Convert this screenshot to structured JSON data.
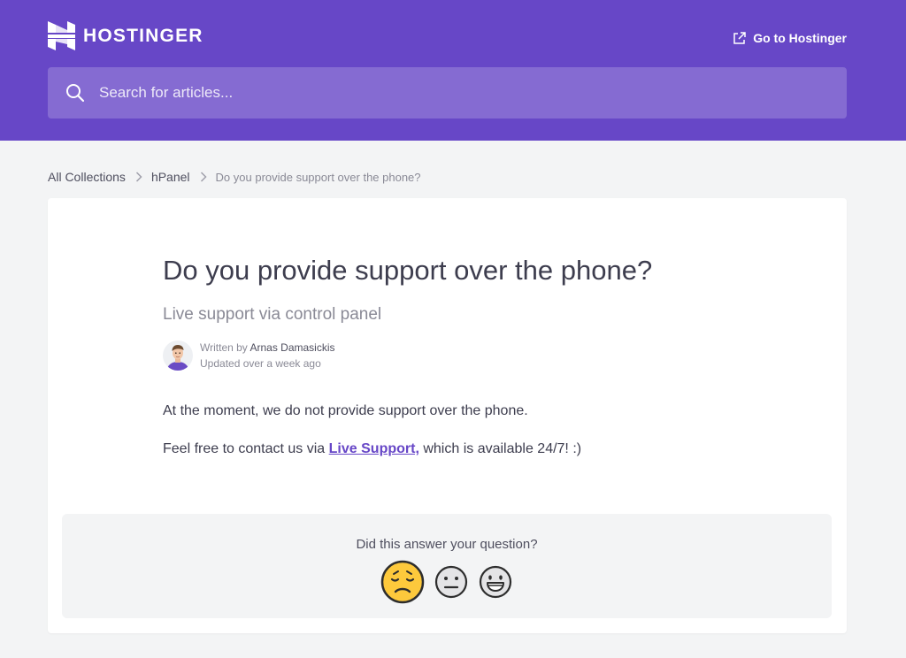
{
  "header": {
    "logo_text": "HOSTINGER",
    "goto_label": "Go to Hostinger",
    "brand_color": "#6747c7"
  },
  "search": {
    "placeholder": "Search for articles..."
  },
  "breadcrumb": {
    "items": [
      "All Collections",
      "hPanel"
    ],
    "current": "Do you provide support over the phone?"
  },
  "article": {
    "title": "Do you provide support over the phone?",
    "subtitle": "Live support via control panel",
    "author": {
      "written_by_prefix": "Written by ",
      "name": "Arnas Damasickis",
      "updated": "Updated over a week ago"
    },
    "paragraph1": "At the moment, we do not provide support over the phone.",
    "paragraph2_prefix": "Feel free to contact us via ",
    "paragraph2_link": "Live Support,",
    "paragraph2_suffix": " which is available 24/7! :)"
  },
  "feedback": {
    "question": "Did this answer your question?",
    "reactions": [
      "disappointed",
      "neutral",
      "smiley"
    ]
  }
}
